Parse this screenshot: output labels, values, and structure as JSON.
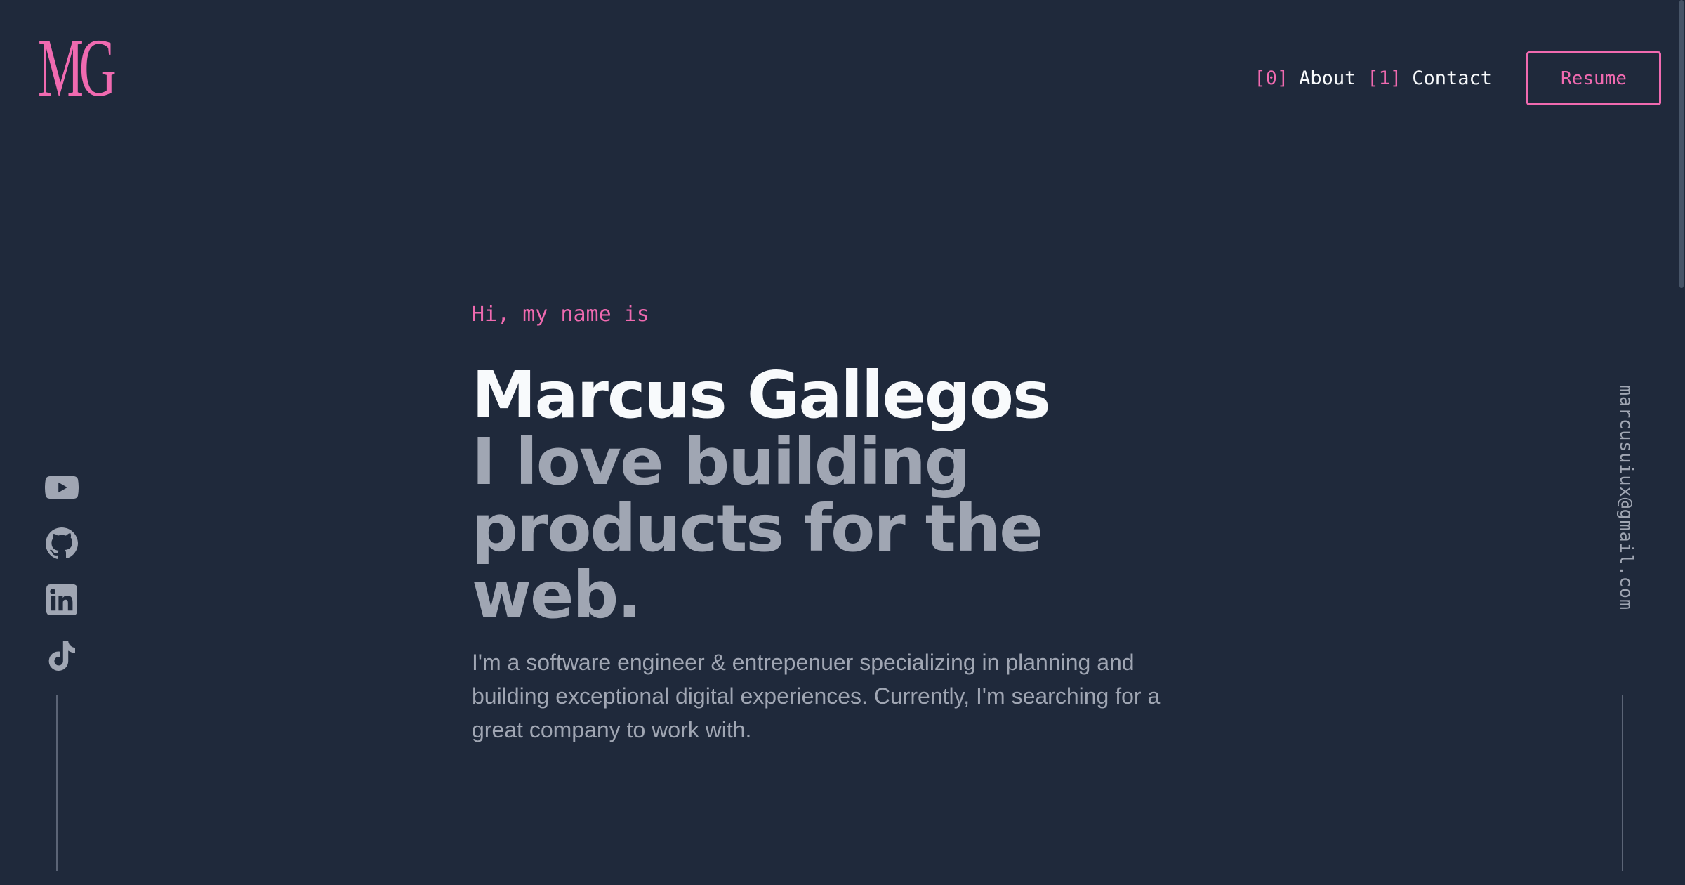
{
  "logo": {
    "text": "MG"
  },
  "nav": {
    "items": [
      {
        "index": "[0]",
        "label": "About"
      },
      {
        "index": "[1]",
        "label": "Contact"
      }
    ],
    "resume_label": "Resume"
  },
  "hero": {
    "greeting": "Hi, my name is",
    "name": "Marcus Gallegos",
    "tagline_line1": "I love building",
    "tagline_line2": "products for the web.",
    "bio": "I'm a software engineer & entrepenuer specializing in planning and building exceptional digital experiences. Currently, I'm searching for a great company to work with."
  },
  "social": {
    "icons": [
      "youtube-icon",
      "github-icon",
      "linkedin-icon",
      "tiktok-icon"
    ]
  },
  "email": "marcusuiux@gmail.com",
  "colors": {
    "background": "#1f293b",
    "accent": "#f06ab0",
    "text_primary": "#f8fafc",
    "text_muted": "#a0a6b3"
  }
}
